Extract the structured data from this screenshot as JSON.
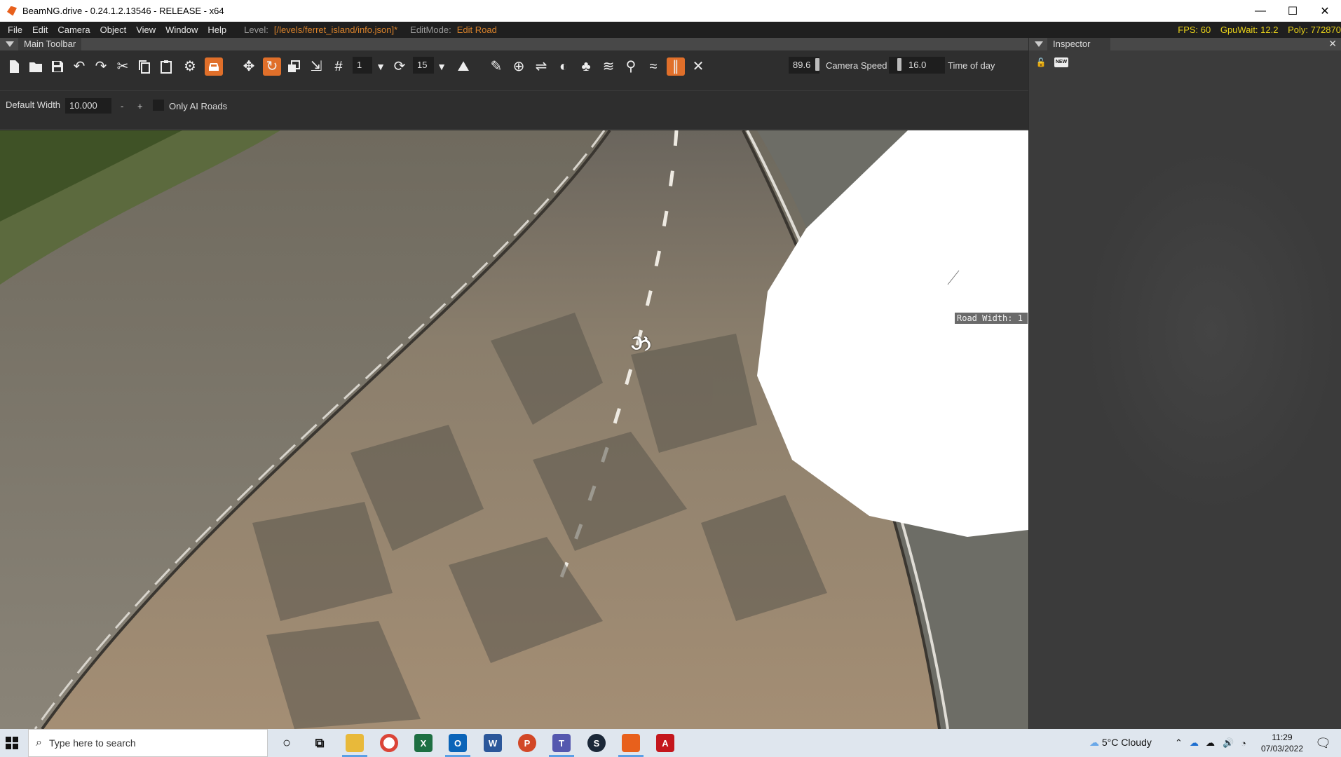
{
  "window": {
    "title": "BeamNG.drive - 0.24.1.2.13546 - RELEASE - x64",
    "min": "—",
    "max": "☐",
    "close": "✕"
  },
  "menu": {
    "items": [
      "File",
      "Edit",
      "Camera",
      "Object",
      "View",
      "Window",
      "Help"
    ],
    "level_label": "Level:",
    "level_value": "[/levels/ferret_island/info.json]*",
    "editmode_label": "EditMode:",
    "editmode_value": "Edit Road",
    "fps": "FPS: 60",
    "gpuwait": "GpuWait: 12.2",
    "poly": "Poly: 772870"
  },
  "main_toolbar": {
    "panel_title": "Main Toolbar",
    "grid_value": "1",
    "snap_value": "15",
    "camera_speed_value": "89.6",
    "camera_speed_label": "Camera Speed",
    "time_value": "16.0",
    "time_label": "Time of day"
  },
  "road_options": {
    "default_width_label": "Default Width",
    "default_width_value": "10.000",
    "minus": "-",
    "plus": "+",
    "only_ai_label": "Only AI Roads",
    "only_ai_checked": false
  },
  "viewport": {
    "tooltip": "Road Width: 1"
  },
  "inspector": {
    "panel_title": "Inspector",
    "new_label": "NEW"
  },
  "taskbar": {
    "search_placeholder": "Type here to search",
    "weather": "5°C  Cloudy",
    "time": "11:29",
    "date": "07/03/2022"
  },
  "colors": {
    "accent": "#e06f2a",
    "stats": "#e8d21a",
    "level": "#d9822b"
  }
}
